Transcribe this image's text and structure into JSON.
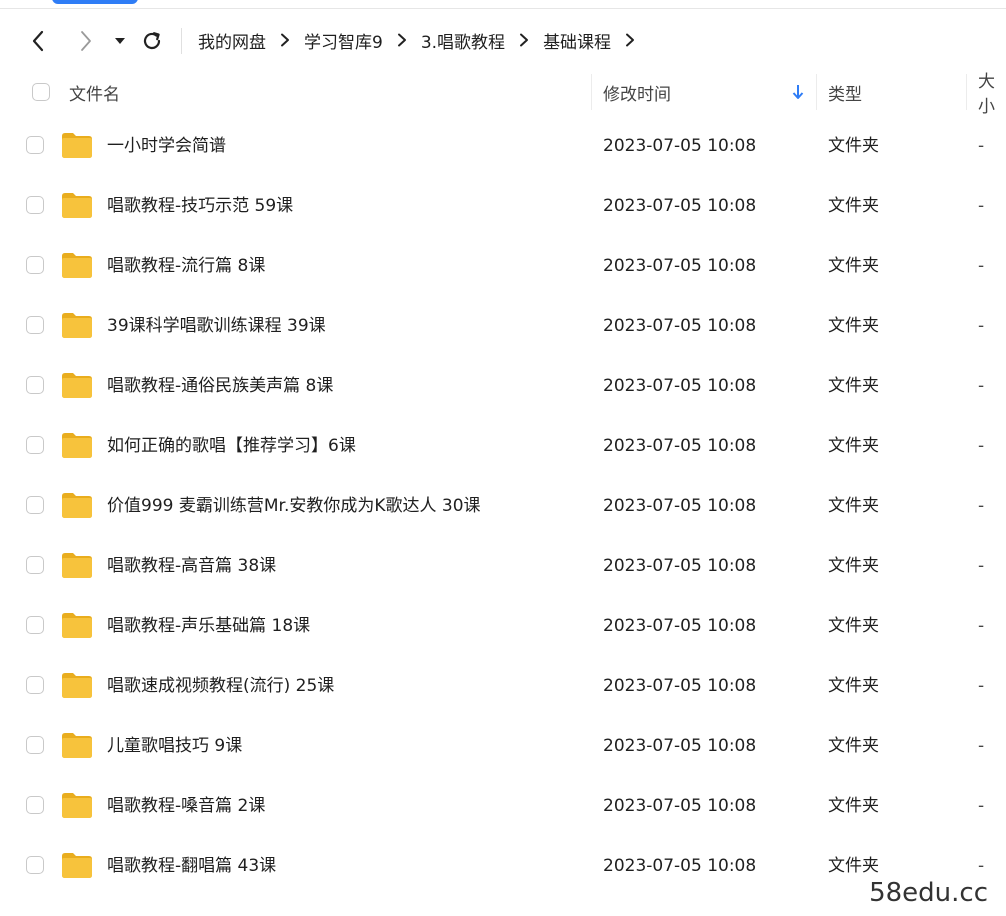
{
  "nav": {
    "breadcrumb": [
      "我的网盘",
      "学习智库9",
      "3.唱歌教程",
      "基础课程"
    ]
  },
  "header": {
    "name": "文件名",
    "modified": "修改时间",
    "type": "类型",
    "size": "大小"
  },
  "rows": [
    {
      "name": "一小时学会简谱",
      "time": "2023-07-05 10:08",
      "type": "文件夹",
      "size": "-"
    },
    {
      "name": "唱歌教程-技巧示范 59课",
      "time": "2023-07-05 10:08",
      "type": "文件夹",
      "size": "-"
    },
    {
      "name": "唱歌教程-流行篇 8课",
      "time": "2023-07-05 10:08",
      "type": "文件夹",
      "size": "-"
    },
    {
      "name": "39课科学唱歌训练课程 39课",
      "time": "2023-07-05 10:08",
      "type": "文件夹",
      "size": "-"
    },
    {
      "name": "唱歌教程-通俗民族美声篇 8课",
      "time": "2023-07-05 10:08",
      "type": "文件夹",
      "size": "-"
    },
    {
      "name": "如何正确的歌唱【推荐学习】6课",
      "time": "2023-07-05 10:08",
      "type": "文件夹",
      "size": "-"
    },
    {
      "name": "价值999 麦霸训练营Mr.安教你成为K歌达人 30课",
      "time": "2023-07-05 10:08",
      "type": "文件夹",
      "size": "-"
    },
    {
      "name": "唱歌教程-高音篇 38课",
      "time": "2023-07-05 10:08",
      "type": "文件夹",
      "size": "-"
    },
    {
      "name": "唱歌教程-声乐基础篇 18课",
      "time": "2023-07-05 10:08",
      "type": "文件夹",
      "size": "-"
    },
    {
      "name": "唱歌速成视频教程(流行) 25课",
      "time": "2023-07-05 10:08",
      "type": "文件夹",
      "size": "-"
    },
    {
      "name": "儿童歌唱技巧 9课",
      "time": "2023-07-05 10:08",
      "type": "文件夹",
      "size": "-"
    },
    {
      "name": "唱歌教程-嗓音篇 2课",
      "time": "2023-07-05 10:08",
      "type": "文件夹",
      "size": "-"
    },
    {
      "name": "唱歌教程-翻唱篇 43课",
      "time": "2023-07-05 10:08",
      "type": "文件夹",
      "size": "-"
    }
  ],
  "watermark": "58edu.cc",
  "colors": {
    "accent": "#2f7df6",
    "folder": "#f7c33c",
    "folderDark": "#e9ad1e"
  },
  "icons": {
    "back": "chevron-left-icon",
    "forward": "chevron-right-icon",
    "history": "caret-down-icon",
    "refresh": "refresh-icon",
    "sort": "arrow-down-icon",
    "folder": "folder-icon"
  }
}
